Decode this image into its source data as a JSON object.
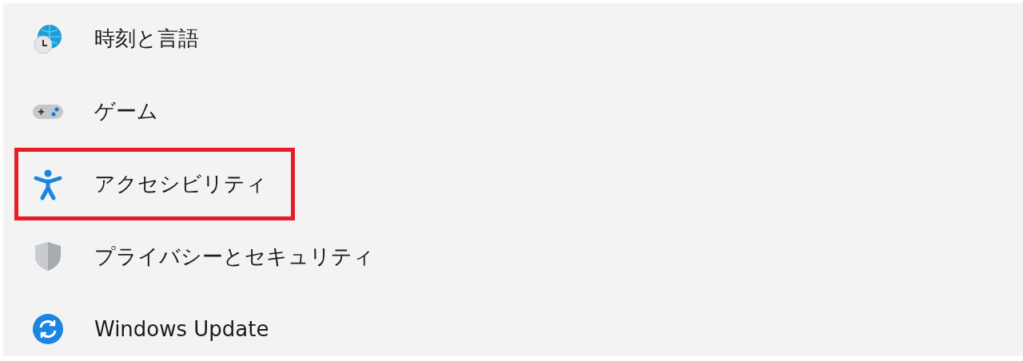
{
  "sidebar": {
    "items": [
      {
        "label": "時刻と言語",
        "highlighted": false
      },
      {
        "label": "ゲーム",
        "highlighted": false
      },
      {
        "label": "アクセシビリティ",
        "highlighted": true
      },
      {
        "label": "プライバシーとセキュリティ",
        "highlighted": false
      },
      {
        "label": "Windows Update",
        "highlighted": false
      }
    ]
  }
}
